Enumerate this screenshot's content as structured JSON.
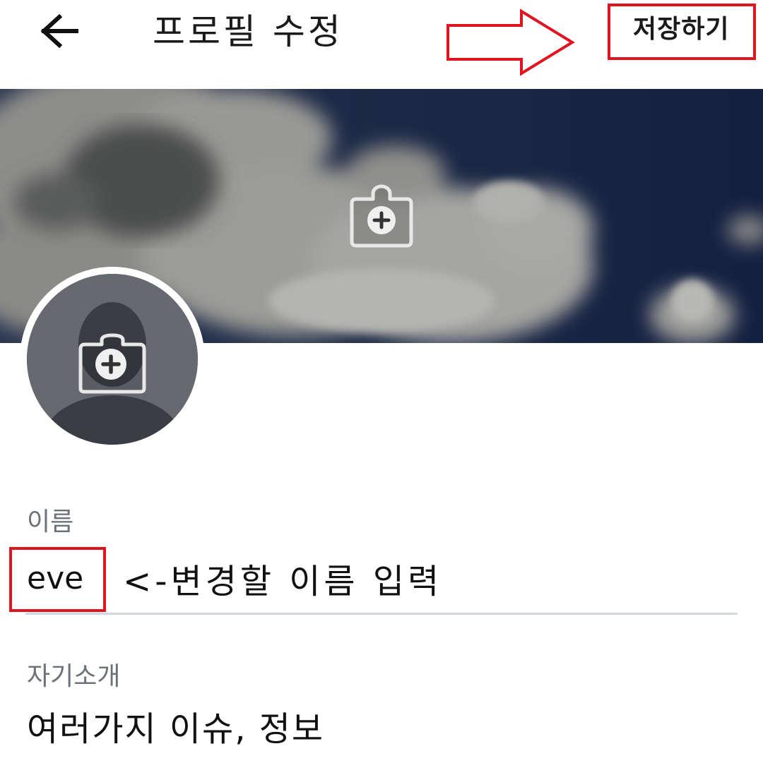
{
  "header": {
    "title": "프로필 수정",
    "save_label": "저장하기",
    "back_icon": "arrow-left-icon"
  },
  "media": {
    "header_camera_icon": "add-photo-icon",
    "avatar_camera_icon": "add-photo-icon"
  },
  "form": {
    "name": {
      "label": "이름",
      "value": "eve"
    },
    "bio": {
      "label": "자기소개",
      "value": "여러가지 이슈, 정보"
    }
  },
  "annotations": {
    "name_hint": "<-변경할 이름 입력",
    "highlight_color": "#e0141e"
  },
  "colors": {
    "label": "#6b7279",
    "divider": "#cfd9de",
    "sky": "#1a2744"
  }
}
